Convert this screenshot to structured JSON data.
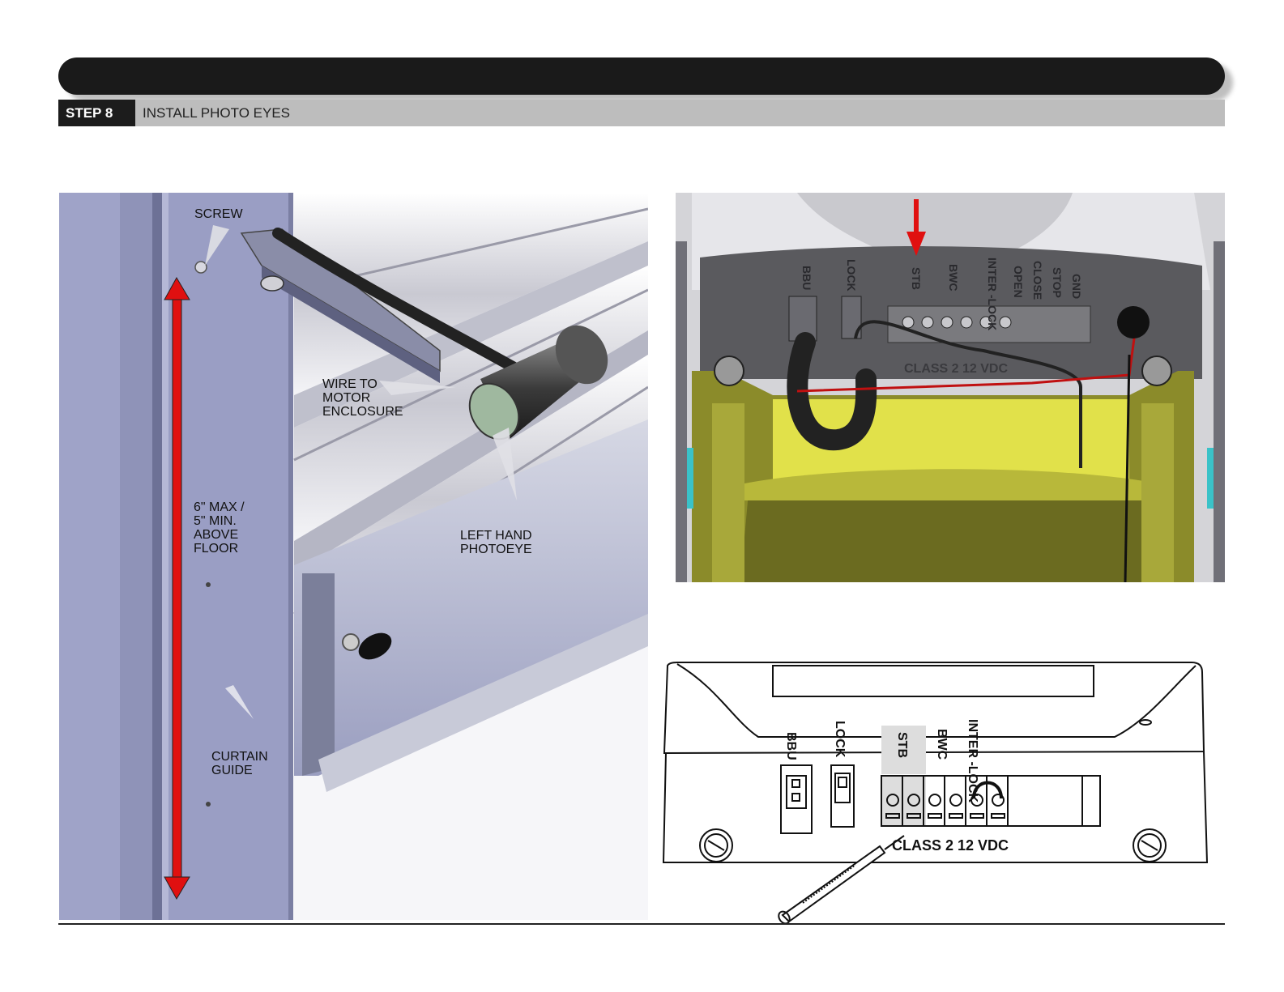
{
  "header": {
    "step_label": "STEP 8",
    "step_title": "INSTALL PHOTO EYES"
  },
  "left_figure": {
    "callouts": {
      "screw": "SCREW",
      "wire": "WIRE TO\nMOTOR\nENCLOSURE",
      "height": "6\" MAX /\n5\" MIN.\nABOVE\nFLOOR",
      "photoeye": "LEFT HAND\nPHOTOEYE",
      "curtain_guide": "CURTAIN\nGUIDE"
    }
  },
  "top_right_figure": {
    "terminal_labels": [
      "BBU",
      "LOCK",
      "STB",
      "BWC",
      "INTER -LOCK",
      "OPEN",
      "CLOSE",
      "STOP",
      "GND"
    ],
    "board_label": "CLASS 2  12 VDC"
  },
  "bottom_right_figure": {
    "terminal_labels": [
      "BBU",
      "LOCK",
      "STB",
      "BWC",
      "INTER -LOCK"
    ],
    "board_label": "CLASS 2  12 VDC"
  },
  "colors": {
    "header_bar": "#1a1a1a",
    "step_strip": "#bdbdbd",
    "curtain_guide": "#9a9ec4",
    "arrow_red": "#e01010",
    "enclosure_yellow": "#cccc2a"
  }
}
